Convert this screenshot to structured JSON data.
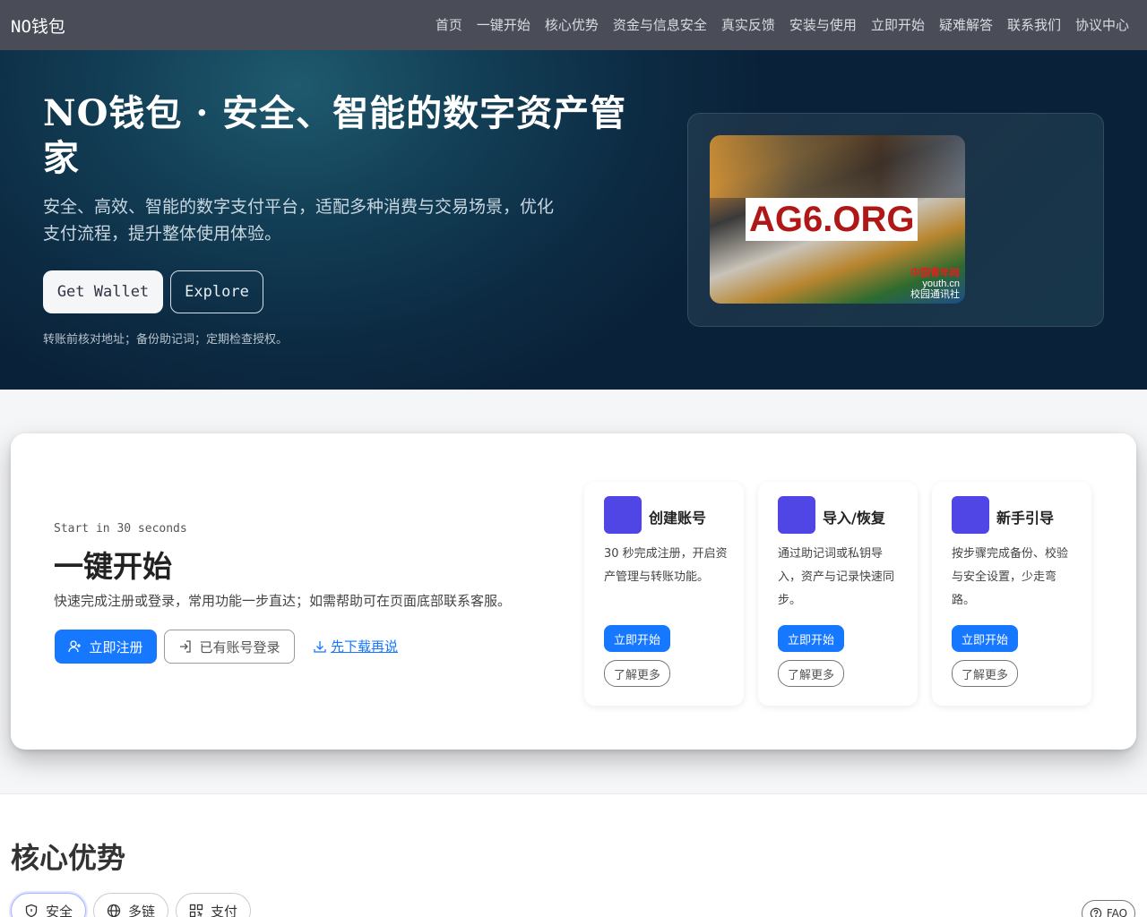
{
  "nav": {
    "brand": "NO钱包",
    "links": [
      "首页",
      "一键开始",
      "核心优势",
      "资金与信息安全",
      "真实反馈",
      "安装与使用",
      "立即开始",
      "疑难解答",
      "联系我们",
      "协议中心"
    ]
  },
  "hero": {
    "title": "NO钱包 · 安全、智能的数字资产管家",
    "subtitle": "安全、高效、智能的数字支付平台，适配多种消费与交易场景，优化支付流程，提升整体使用体验。",
    "primary_button": "Get Wallet",
    "secondary_button": "Explore",
    "note": "转账前核对地址；备份助记词；定期检查授权。",
    "image_watermark": "AG6.ORG",
    "image_logo_line1": "中国青年网",
    "image_logo_line2": "youth.cn",
    "image_logo_line3": "校园通讯社"
  },
  "quick_start": {
    "kicker": "Start in 30 seconds",
    "title": "一键开始",
    "description": "快速完成注册或登录，常用功能一步直达；如需帮助可在页面底部联系客服。",
    "register_button": "立即注册",
    "login_button": "已有账号登录",
    "download_link": "先下载再说",
    "cards": [
      {
        "title": "创建账号",
        "description": "30 秒完成注册，开启资产管理与转账功能。",
        "go": "立即开始",
        "more": "了解更多"
      },
      {
        "title": "导入/恢复",
        "description": "通过助记词或私钥导入，资产与记录快速同步。",
        "go": "立即开始",
        "more": "了解更多"
      },
      {
        "title": "新手引导",
        "description": "按步骤完成备份、校验与安全设置，少走弯路。",
        "go": "立即开始",
        "more": "了解更多"
      }
    ]
  },
  "advantages": {
    "title": "核心优势",
    "tabs": [
      "安全",
      "多链",
      "支付"
    ],
    "faq": "FAQ"
  },
  "colors": {
    "nav_bg": "#4a4d57",
    "accent": "#1677ff",
    "card_icon": "#5046e5",
    "hero_dark": "#0c2b43"
  }
}
